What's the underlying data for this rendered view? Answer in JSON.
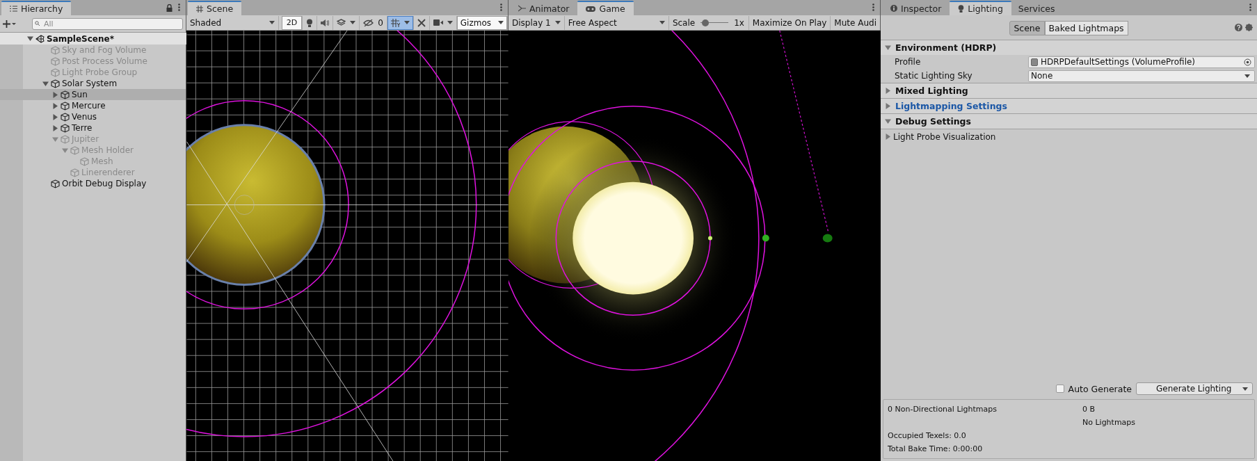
{
  "hierarchy": {
    "tab": "Hierarchy",
    "search": {
      "placeholder": "All"
    },
    "scene": {
      "name": "SampleScene*",
      "expanded": true
    },
    "items": [
      {
        "name": "Sky and Fog Volume",
        "disabled": true,
        "selected": false
      },
      {
        "name": "Post Process Volume",
        "disabled": true,
        "selected": false
      },
      {
        "name": "Light Probe Group",
        "disabled": true,
        "selected": false
      },
      {
        "name": "Solar System",
        "disabled": false,
        "selected": false,
        "expanded": true,
        "children": [
          {
            "name": "Sun",
            "disabled": false,
            "selected": true,
            "expanded": false
          },
          {
            "name": "Mercure",
            "disabled": false,
            "selected": false,
            "expanded": false
          },
          {
            "name": "Venus",
            "disabled": false,
            "selected": false,
            "expanded": false
          },
          {
            "name": "Terre",
            "disabled": false,
            "selected": false,
            "expanded": false
          },
          {
            "name": "Jupiter",
            "disabled": true,
            "selected": false,
            "expanded": true,
            "children": [
              {
                "name": "Mesh Holder",
                "disabled": true,
                "selected": false,
                "expanded": true,
                "children": [
                  {
                    "name": "Mesh",
                    "disabled": true,
                    "selected": false
                  }
                ]
              },
              {
                "name": "Linerenderer",
                "disabled": true,
                "selected": false
              }
            ]
          }
        ]
      },
      {
        "name": "Orbit Debug Display",
        "disabled": false,
        "selected": false
      }
    ]
  },
  "scene_view": {
    "tab": "Scene",
    "toolbar": {
      "shading": "Shaded",
      "mode_2d": {
        "label": "2D",
        "on": true
      },
      "hidden_count": "0",
      "grid": {
        "selected": true
      },
      "gizmos": "Gizmos"
    }
  },
  "game_view": {
    "tabs": [
      {
        "label": "Animator",
        "selected": false
      },
      {
        "label": "Game",
        "selected": true
      }
    ],
    "toolbar": {
      "display": "Display 1",
      "aspect": "Free Aspect",
      "scale_label": "Scale",
      "scale": {
        "level": 0.05
      },
      "scale_value": "1x",
      "maximize": "Maximize On Play",
      "mute": "Mute Audi"
    }
  },
  "lighting": {
    "tabs": [
      {
        "label": "Inspector",
        "selected": false
      },
      {
        "label": "Lighting",
        "selected": true
      },
      {
        "label": "Services",
        "selected": false
      }
    ],
    "modes": [
      {
        "label": "Scene",
        "selected": true
      },
      {
        "label": "Baked Lightmaps",
        "selected": false
      }
    ],
    "sections": [
      {
        "title": "Environment (HDRP)",
        "expanded": true,
        "highlighted": false,
        "fields": [
          {
            "label": "Profile",
            "kind": "object",
            "value": "HDRPDefaultSettings (VolumeProfile)"
          },
          {
            "label": "Static Lighting Sky",
            "kind": "dropdown",
            "value": "None"
          }
        ]
      },
      {
        "title": "Mixed Lighting",
        "expanded": false,
        "highlighted": false
      },
      {
        "title": "Lightmapping Settings",
        "expanded": false,
        "highlighted": true
      },
      {
        "title": "Debug Settings",
        "expanded": true,
        "highlighted": false,
        "foldouts": [
          {
            "label": "Light Probe Visualization",
            "expanded": false
          }
        ]
      }
    ],
    "auto_generate": {
      "label": "Auto Generate",
      "checked": false
    },
    "generate_button": "Generate Lighting",
    "stats": [
      {
        "label": "0 Non-Directional Lightmaps",
        "value": "0 B"
      },
      {
        "value": "No Lightmaps"
      },
      {
        "label": "Occupied Texels: 0.0"
      },
      {
        "label": "Total Bake Time: 0:00:00"
      }
    ]
  }
}
